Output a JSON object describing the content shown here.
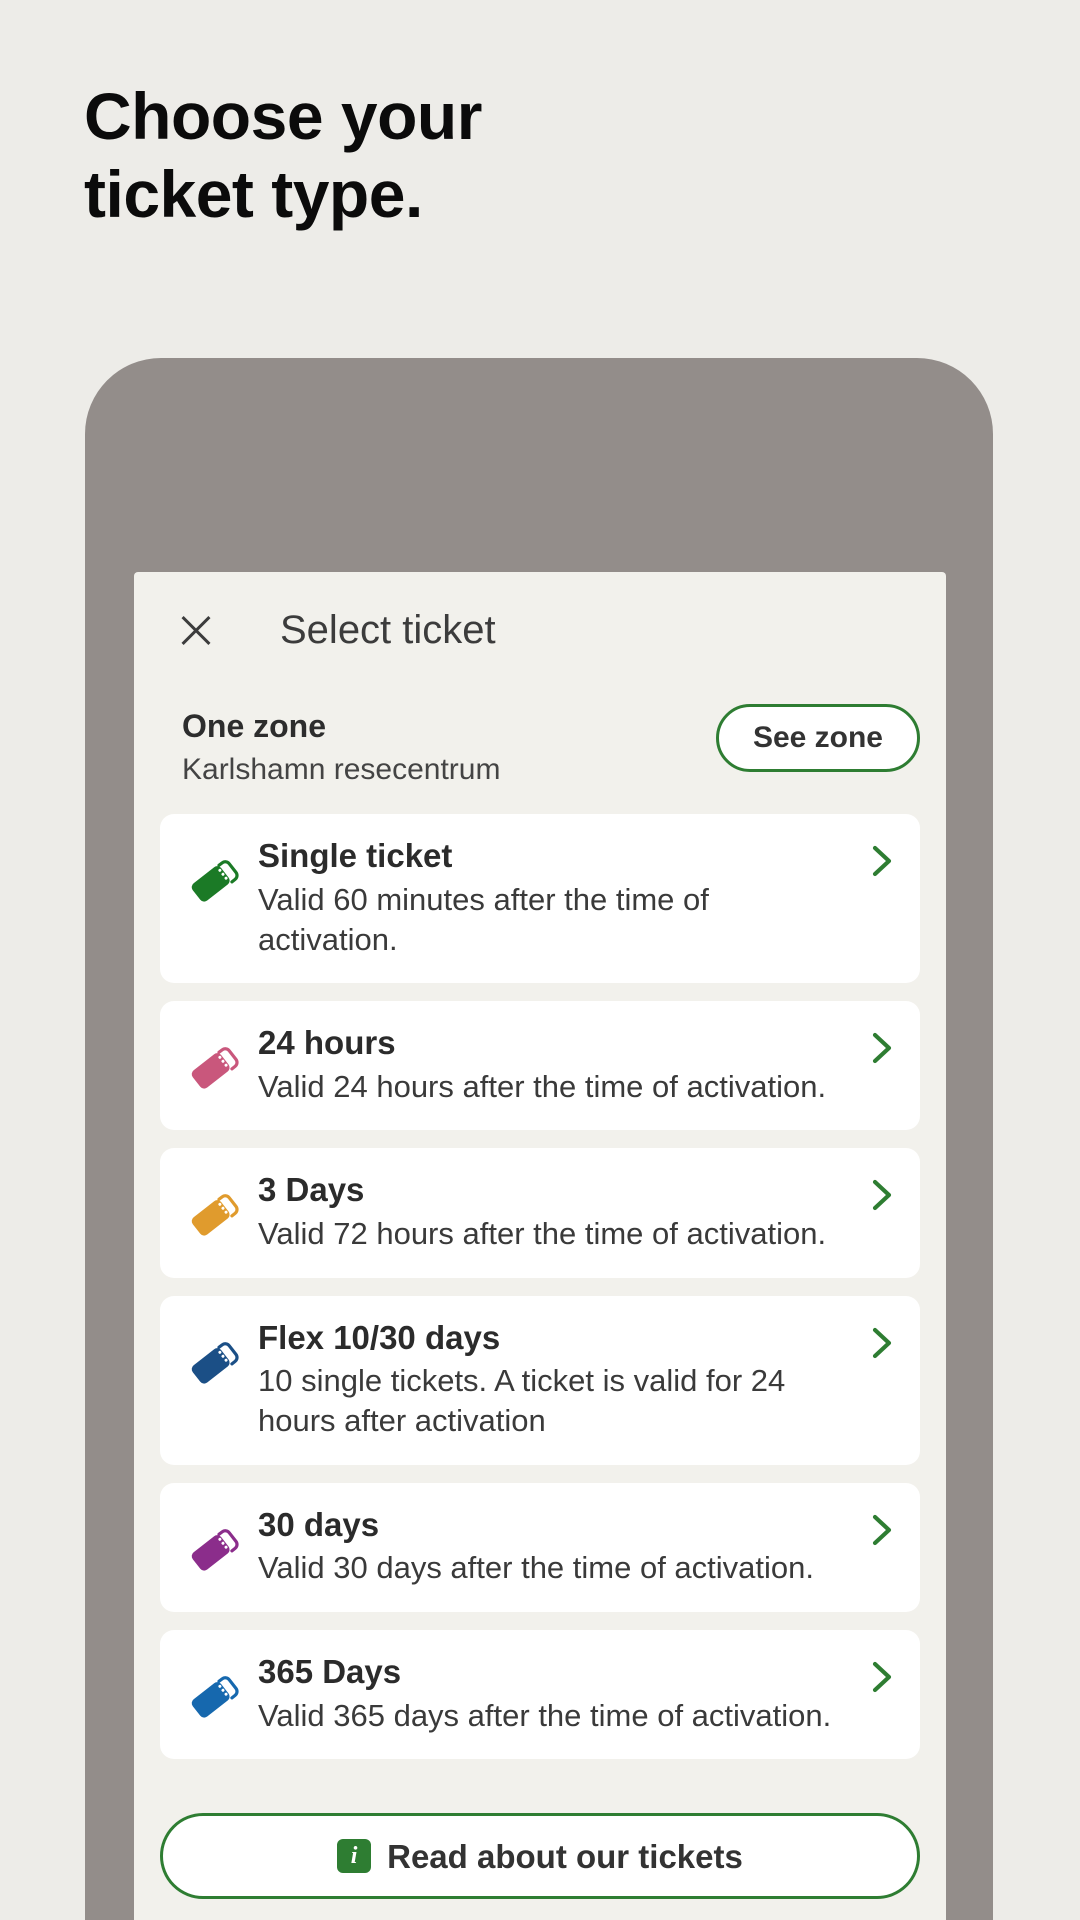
{
  "page": {
    "headline": "Choose your\nticket type.",
    "background_color": "#EDECE8",
    "accent_green": "#2E7D32"
  },
  "phone": {
    "frame_color": "#938D8A"
  },
  "sheet": {
    "title": "Select ticket",
    "close_icon": "close-icon",
    "background_color": "#F2F1EC",
    "zone": {
      "title": "One zone",
      "subtitle": "Karlshamn resecentrum",
      "see_zone_label": "See zone"
    },
    "tickets": [
      {
        "title": "Single ticket",
        "description": "Valid 60 minutes after the time of activation.",
        "icon": "ticket-icon",
        "icon_color": "#1B7A26",
        "chevron": "chevron-right-icon"
      },
      {
        "title": "24 hours",
        "description": "Valid 24 hours after the time of activation.",
        "icon": "ticket-icon",
        "icon_color": "#C9577C",
        "chevron": "chevron-right-icon"
      },
      {
        "title": "3 Days",
        "description": "Valid 72 hours after the time of activation.",
        "icon": "ticket-icon",
        "icon_color": "#E09B2D",
        "chevron": "chevron-right-icon"
      },
      {
        "title": "Flex 10/30 days",
        "description": "10 single tickets. A ticket is valid for 24 hours after activation",
        "icon": "ticket-icon",
        "icon_color": "#1B4F86",
        "chevron": "chevron-right-icon"
      },
      {
        "title": "30 days",
        "description": "Valid 30 days after the time of activation.",
        "icon": "ticket-icon",
        "icon_color": "#8B2D8B",
        "chevron": "chevron-right-icon"
      },
      {
        "title": "365 Days",
        "description": "Valid 365 days after the time of activation.",
        "icon": "ticket-icon",
        "icon_color": "#1668AE",
        "chevron": "chevron-right-icon"
      }
    ],
    "read_button": {
      "label": "Read about our tickets",
      "icon": "info-icon",
      "icon_glyph": "i"
    }
  }
}
